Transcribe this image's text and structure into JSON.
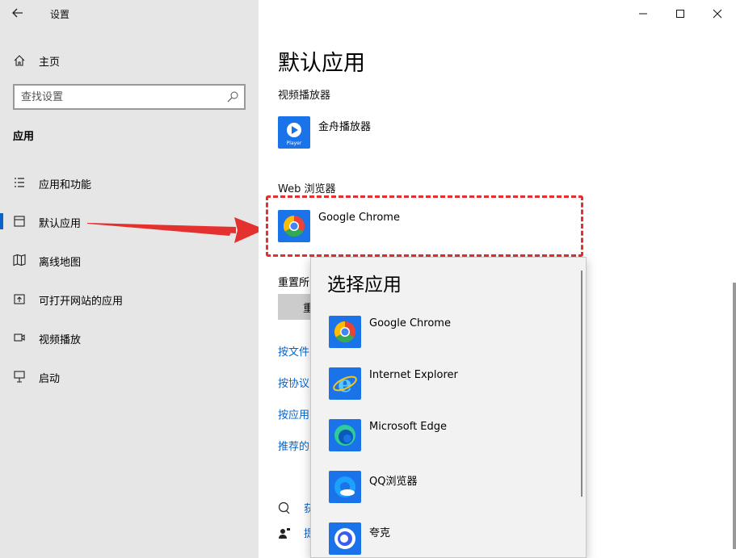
{
  "window": {
    "title": "设置",
    "back_icon": "back-arrow-icon"
  },
  "sidebar": {
    "home_label": "主页",
    "search_placeholder": "查找设置",
    "section": "应用",
    "items": [
      {
        "label": "应用和功能",
        "icon": "apps-list-icon",
        "selected": false
      },
      {
        "label": "默认应用",
        "icon": "default-apps-icon",
        "selected": true
      },
      {
        "label": "离线地图",
        "icon": "map-icon",
        "selected": false
      },
      {
        "label": "可打开网站的应用",
        "icon": "open-web-icon",
        "selected": false
      },
      {
        "label": "视频播放",
        "icon": "video-icon",
        "selected": false
      },
      {
        "label": "启动",
        "icon": "startup-icon",
        "selected": false
      }
    ]
  },
  "main": {
    "title": "默认应用",
    "video_label": "视频播放器",
    "video_app": "金舟播放器",
    "browser_label": "Web 浏览器",
    "browser_app": "Google Chrome",
    "reset_label": "重置所",
    "reset_button": "重",
    "links": [
      "按文件",
      "按协议",
      "按应用",
      "推荐的"
    ],
    "help_links": [
      "获",
      "提"
    ]
  },
  "flyout": {
    "title": "选择应用",
    "apps": [
      {
        "name": "Google Chrome",
        "icon": "chrome-icon"
      },
      {
        "name": "Internet Explorer",
        "icon": "ie-icon"
      },
      {
        "name": "Microsoft Edge",
        "icon": "edge-icon"
      },
      {
        "name": "QQ浏览器",
        "icon": "qq-browser-icon"
      },
      {
        "name": "夸克",
        "icon": "quark-icon"
      }
    ]
  },
  "colors": {
    "accent": "#0a64c8",
    "highlight": "#e53030",
    "sidebar_bg": "#e6e6e6"
  }
}
